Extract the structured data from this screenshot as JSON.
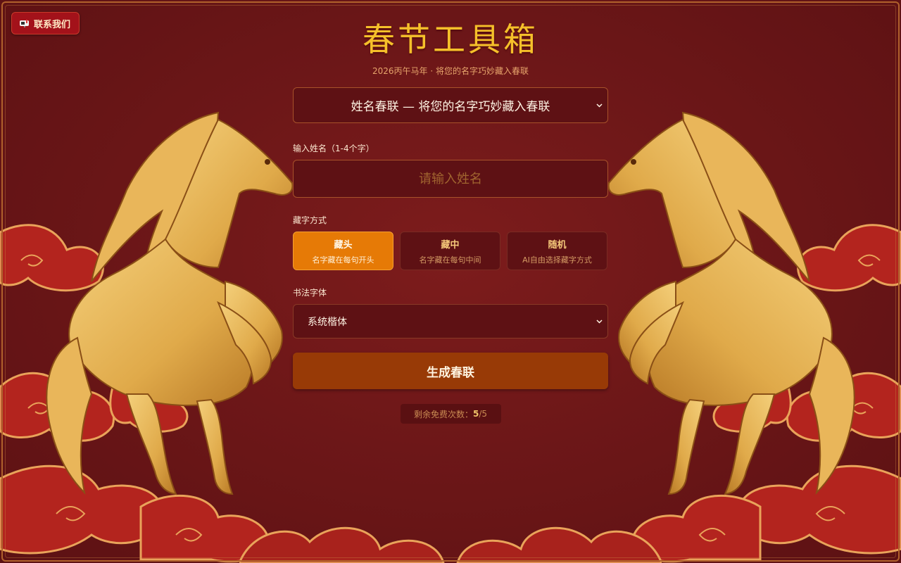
{
  "contact_button": {
    "label": "联系我们",
    "icon": "mailbox-icon"
  },
  "header": {
    "title": "春节工具箱",
    "subtitle": "2026丙午马年 · 将您的名字巧妙藏入春联"
  },
  "tool_select": {
    "value": "姓名春联 — 将您的名字巧妙藏入春联"
  },
  "name_field": {
    "label": "输入姓名（1-4个字）",
    "placeholder": "请输入姓名",
    "value": ""
  },
  "hide_mode": {
    "label": "藏字方式",
    "options": [
      {
        "title": "藏头",
        "desc": "名字藏在每句开头",
        "selected": true
      },
      {
        "title": "藏中",
        "desc": "名字藏在每句中间",
        "selected": false
      },
      {
        "title": "随机",
        "desc": "AI自由选择藏字方式",
        "selected": false
      }
    ]
  },
  "font_field": {
    "label": "书法字体",
    "value": "系统楷体"
  },
  "generate_button": {
    "label": "生成春联"
  },
  "quota": {
    "prefix": "剩余免费次数：",
    "remaining": "5",
    "total": "/5"
  },
  "colors": {
    "background": "#6a1416",
    "title_gold": "#f5c02a",
    "active_orange": "#e67a06",
    "button_brown": "#983a06",
    "horse_gold": "#e0aa4a",
    "cloud_red": "#b8261f"
  }
}
